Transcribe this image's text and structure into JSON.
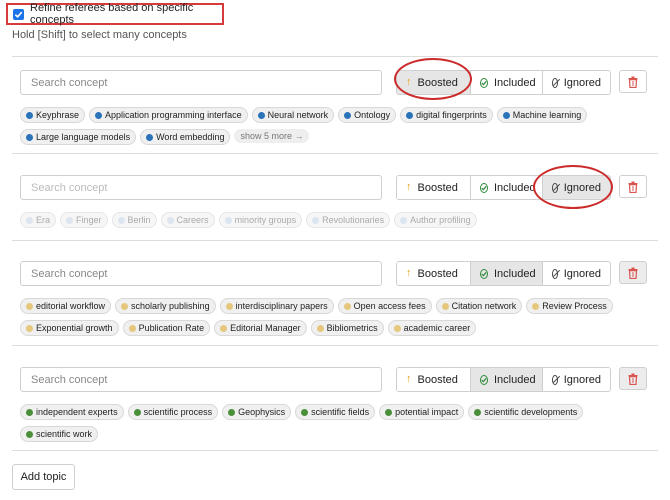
{
  "header": {
    "refine_label": "Refine referees based on specific concepts",
    "refine_checked": true,
    "hint": "Hold [Shift] to select many concepts"
  },
  "buttons": {
    "boosted": "Boosted",
    "included": "Included",
    "ignored": "Ignored",
    "add_topic": "Add topic"
  },
  "topics": [
    {
      "search_placeholder": "Search concept",
      "active_mode": "boosted",
      "dot_color": "#2a73b8",
      "concepts": [
        "Keyphrase",
        "Application programming interface",
        "Neural network",
        "Ontology",
        "digital fingerprints",
        "Machine learning",
        "Large language models",
        "Word embedding"
      ],
      "more_label": "show 5 more →"
    },
    {
      "search_placeholder": "Search concept",
      "active_mode": "ignored",
      "dot_color": "#dde6f0",
      "concepts": [
        "Era",
        "Finger",
        "Berlin",
        "Careers",
        "minority groups",
        "Revolutionaries",
        "Author profiling"
      ]
    },
    {
      "search_placeholder": "Search concept",
      "active_mode": "included",
      "dot_color": "#e6c77e",
      "concepts": [
        "editorial workflow",
        "scholarly publishing",
        "interdisciplinary papers",
        "Open access fees",
        "Citation network",
        "Review Process",
        "Exponential growth",
        "Publication Rate",
        "Editorial Manager",
        "Bibliometrics",
        "academic career"
      ]
    },
    {
      "search_placeholder": "Search concept",
      "active_mode": "included",
      "dot_color": "#4a8f3a",
      "concepts": [
        "independent experts",
        "scientific process",
        "Geophysics",
        "scientific fields",
        "potential impact",
        "scientific developments",
        "scientific work"
      ]
    }
  ],
  "colors": {
    "accent_red": "#d63a3a",
    "checkbox_blue": "#1a73e8",
    "boost_arrow": "#e8a21a",
    "include_check": "#2e8b3a",
    "trash_red": "#d9534f"
  }
}
